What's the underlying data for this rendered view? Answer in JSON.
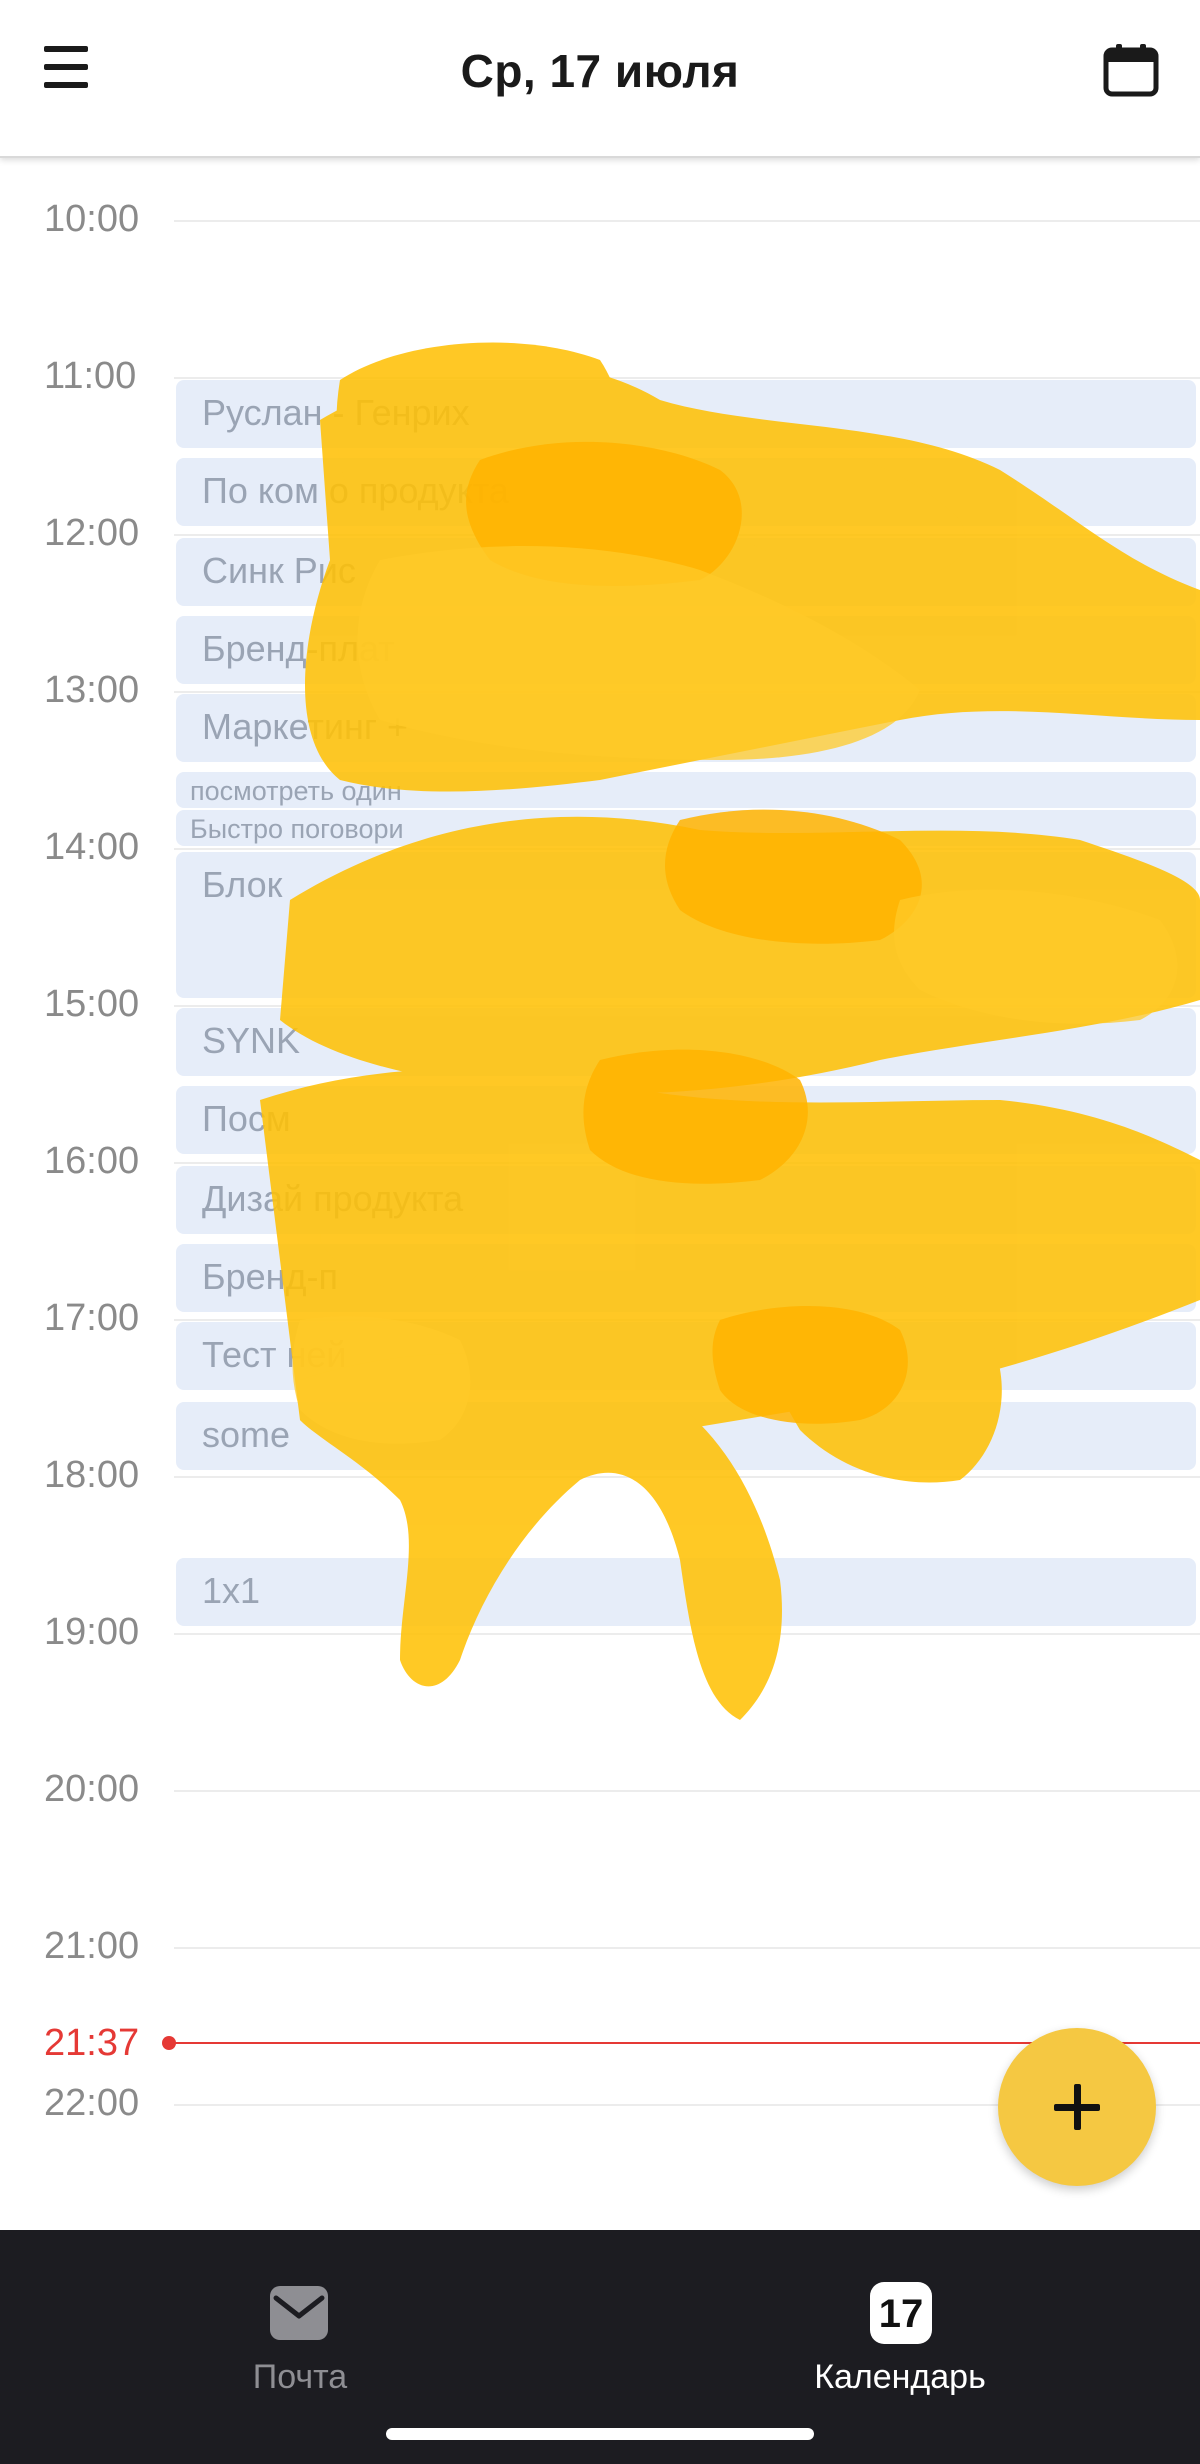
{
  "header": {
    "title": "Ср, 17 июля",
    "menu_icon": "hamburger-menu-icon",
    "calendar_icon": "calendar-icon"
  },
  "hours": [
    "10:00",
    "11:00",
    "12:00",
    "13:00",
    "14:00",
    "15:00",
    "16:00",
    "17:00",
    "18:00",
    "19:00",
    "20:00",
    "21:00",
    "22:00"
  ],
  "events": [
    {
      "title": "Руслан - Генрих"
    },
    {
      "title": "По ком                                 о продукта"
    },
    {
      "title": "Синк Рис"
    },
    {
      "title": "Бренд-плат"
    },
    {
      "title": "Маркетинг +"
    },
    {
      "title": "посмотреть один"
    },
    {
      "title": "Быстро поговори"
    },
    {
      "title": "Блок"
    },
    {
      "title": "SYNK"
    },
    {
      "title": "Посм"
    },
    {
      "title": "Дизай                              продукта"
    },
    {
      "title": "Бренд-п"
    },
    {
      "title": "Тест ней"
    },
    {
      "title": "some"
    },
    {
      "title": "1x1"
    }
  ],
  "now": {
    "time": "21:37",
    "color": "#e53935"
  },
  "fab": {
    "icon": "plus-icon",
    "color": "#f5c842"
  },
  "tabbar": {
    "mail": {
      "label": "Почта",
      "icon": "mail-icon"
    },
    "calendar": {
      "label": "Календарь",
      "day": "17"
    }
  },
  "colors": {
    "event_bg": "#e6edf9",
    "tabbar_bg": "#1c1c21",
    "scribble": "#ffc107"
  }
}
